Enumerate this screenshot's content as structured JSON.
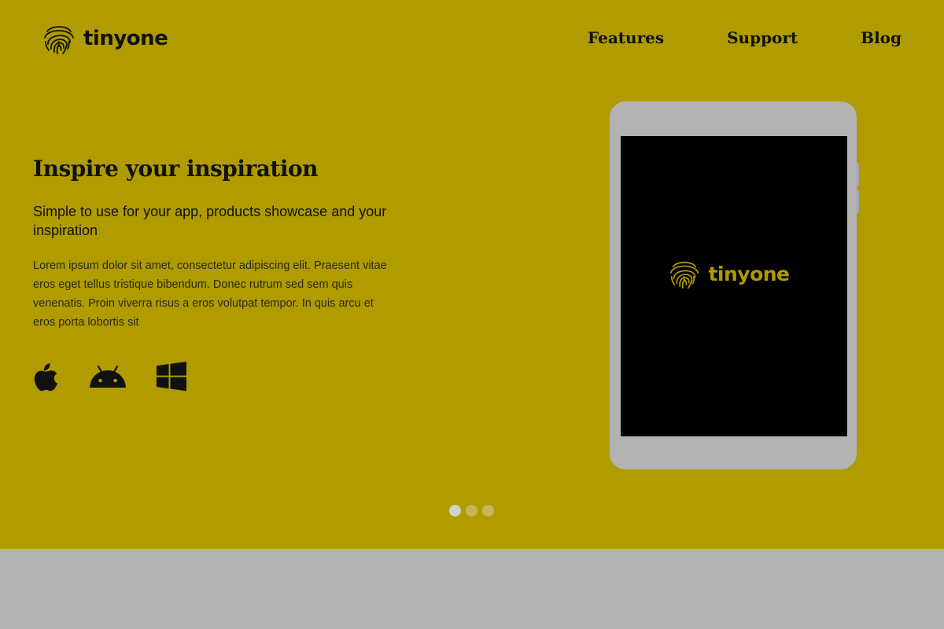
{
  "header": {
    "brand_name": "tinyone",
    "logo_icon": "fingerprint-icon",
    "nav": [
      {
        "label": "Features"
      },
      {
        "label": "Support"
      },
      {
        "label": "Blog"
      }
    ]
  },
  "hero": {
    "headline": "Inspire your inspiration",
    "subhead": "Simple to use for your app, products showcase and your inspiration",
    "body": "Lorem ipsum dolor sit amet, consectetur adipiscing elit. Praesent vitae eros eget tellus tristique bibendum. Donec rutrum sed sem quis venenatis. Proin viverra risus a eros volutpat tempor. In quis arcu et eros porta lobortis sit",
    "platforms": [
      "apple-icon",
      "android-icon",
      "windows-icon"
    ],
    "device": {
      "type": "tablet",
      "screen_brand": "tinyone"
    },
    "carousel": {
      "total_slides": 3,
      "active_index": 0
    }
  },
  "colors": {
    "hero_background": "#b09b00",
    "footer_band": "#b3b3b3",
    "tablet_frame": "#b3b3b3",
    "tablet_screen": "#000000",
    "text": "#111111",
    "screen_logo": "#b09b00"
  }
}
